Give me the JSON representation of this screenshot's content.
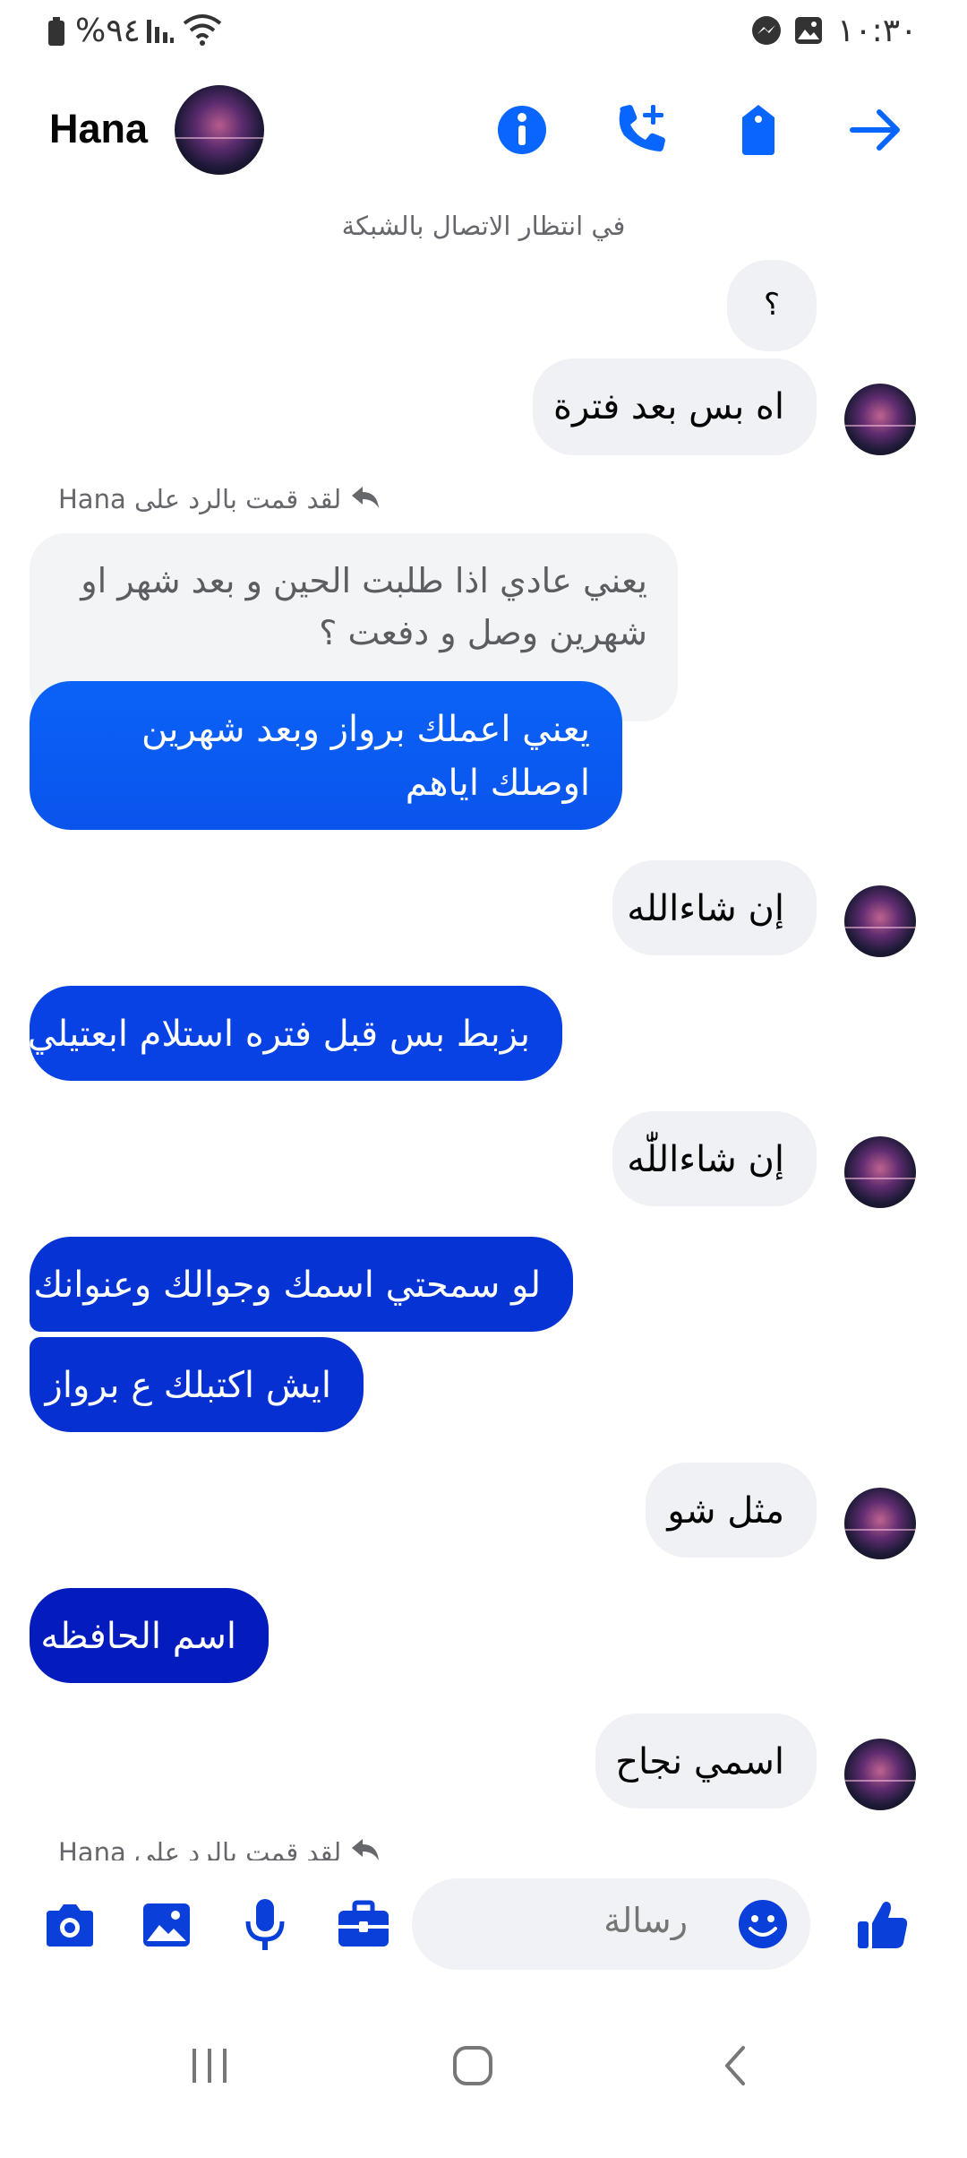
{
  "status_bar": {
    "time": "١٠:٣٠",
    "battery": "%٩٤"
  },
  "header": {
    "contact_name": "Hana"
  },
  "connection_status": "في انتظار الاتصال بالشبكة",
  "messages": [
    {
      "side": "in",
      "text": "؟"
    },
    {
      "side": "in",
      "text": "اه بس بعد فترة"
    },
    {
      "reply_note": "لقد قمت بالرد على Hana"
    },
    {
      "side": "quoted",
      "text": "يعني عادي اذا طلبت الحين و بعد شهر او شهرين وصل و دفعت ؟"
    },
    {
      "side": "out",
      "text": "يعني اعملك برواز وبعد شهرين اوصلك اياهم"
    },
    {
      "side": "in",
      "text": "إن شاءالله"
    },
    {
      "side": "out",
      "text": "بزبط بس قبل فتره استلام ابعتيلي"
    },
    {
      "side": "in",
      "text": "إن شاءاللّٰه"
    },
    {
      "side": "out",
      "text": "لو سمحتي اسمك وجوالك وعنوانك"
    },
    {
      "side": "out",
      "text": "ايش اكتبلك ع برواز"
    },
    {
      "side": "in",
      "text": "مثل شو"
    },
    {
      "side": "out",
      "text": "اسم الحافظه"
    },
    {
      "side": "in",
      "text": "اسمي نجاح"
    },
    {
      "reply_note": "لقد قمت بالرد على Hana"
    }
  ],
  "composer": {
    "placeholder": "رسالة"
  },
  "colors": {
    "accent": "#0866ff",
    "out_top": "#0a5af0",
    "out_mid": "#0632d6",
    "out_bottom": "#0418b8",
    "incoming": "#eff1f5"
  }
}
